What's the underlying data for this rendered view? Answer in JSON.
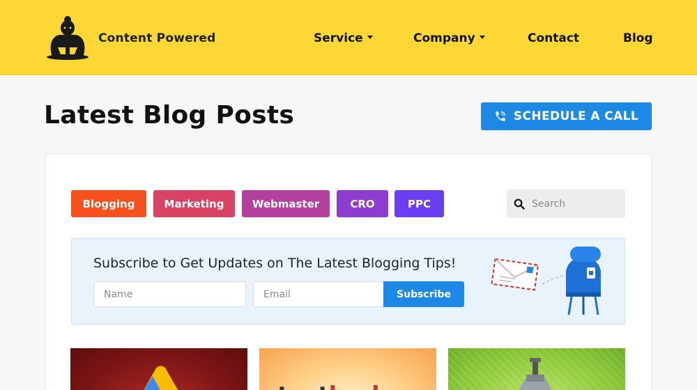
{
  "header": {
    "brand": "Content Powered",
    "nav": [
      {
        "label": "Service",
        "has_dropdown": true
      },
      {
        "label": "Company",
        "has_dropdown": true
      },
      {
        "label": "Contact",
        "has_dropdown": false
      },
      {
        "label": "Blog",
        "has_dropdown": false
      }
    ],
    "logo_icon": "sumo-wrestler-icon",
    "background": "#fdd835"
  },
  "page": {
    "title": "Latest Blog Posts",
    "cta_label": "SCHEDULE A CALL",
    "cta_icon": "phone-icon",
    "accent": "#1e88e5"
  },
  "categories": [
    {
      "label": "Blogging",
      "color": "#f4511e"
    },
    {
      "label": "Marketing",
      "color": "#d84363"
    },
    {
      "label": "Webmaster",
      "color": "#b43f9e"
    },
    {
      "label": "CRO",
      "color": "#8e3ccf"
    },
    {
      "label": "PPC",
      "color": "#6a3ff0"
    }
  ],
  "search": {
    "placeholder": "Search",
    "icon": "search-icon"
  },
  "subscribe": {
    "heading": "Subscribe to Get Updates on The Latest Blogging Tips!",
    "name_placeholder": "Name",
    "email_placeholder": "Email",
    "button_label": "Subscribe",
    "illustration": "mailbox-envelope-icon"
  },
  "posts": [
    {
      "thumbnail": "google-ads-logo"
    },
    {
      "thumbnail": "textbroker-logo",
      "partial_text_1": "text",
      "partial_text_2": "broker"
    },
    {
      "thumbnail": "green-machine-illustration"
    }
  ]
}
